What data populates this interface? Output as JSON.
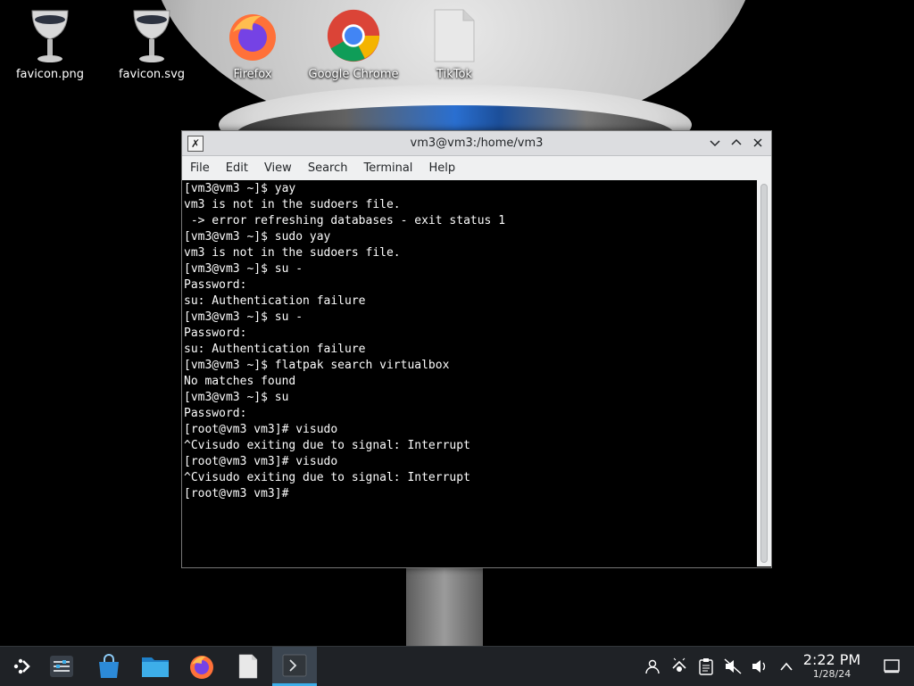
{
  "desktop": {
    "icons": [
      {
        "label": "favicon.png",
        "icon": "wine-glass-icon"
      },
      {
        "label": "favicon.svg",
        "icon": "wine-glass-icon"
      },
      {
        "label": "Firefox",
        "icon": "firefox-icon"
      },
      {
        "label": "Google Chrome",
        "icon": "chrome-icon"
      },
      {
        "label": "TikTok",
        "icon": "file-icon"
      }
    ]
  },
  "window": {
    "title": "vm3@vm3:/home/vm3",
    "menu": [
      "File",
      "Edit",
      "View",
      "Search",
      "Terminal",
      "Help"
    ],
    "terminal_lines": [
      "[vm3@vm3 ~]$ yay",
      "vm3 is not in the sudoers file.",
      " -> error refreshing databases - exit status 1",
      "[vm3@vm3 ~]$ sudo yay",
      "vm3 is not in the sudoers file.",
      "[vm3@vm3 ~]$ su -",
      "Password:",
      "su: Authentication failure",
      "[vm3@vm3 ~]$ su -",
      "Password:",
      "su: Authentication failure",
      "[vm3@vm3 ~]$ flatpak search virtualbox",
      "No matches found",
      "[vm3@vm3 ~]$ su",
      "Password:",
      "[root@vm3 vm3]# visudo",
      "^Cvisudo exiting due to signal: Interrupt",
      "[root@vm3 vm3]# visudo",
      "^Cvisudo exiting due to signal: Interrupt",
      "[root@vm3 vm3]#"
    ]
  },
  "taskbar": {
    "clock_time": "2:22 PM",
    "clock_date": "1/28/24"
  },
  "colors": {
    "accent": "#3daee9",
    "taskbar_bg": "#1f2226",
    "titlebar_bg": "#dcdde0"
  }
}
